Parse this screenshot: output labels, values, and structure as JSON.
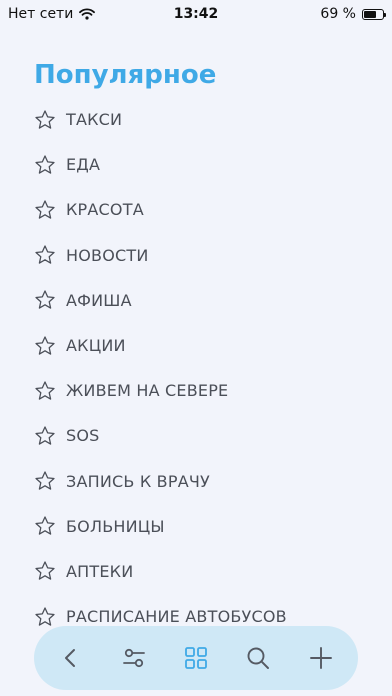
{
  "status_bar": {
    "carrier": "Нет сети",
    "time": "13:42",
    "battery": "69 %",
    "battery_level": 0.69
  },
  "page": {
    "title": "Популярное"
  },
  "items": [
    {
      "label": "ТАКСИ"
    },
    {
      "label": "ЕДА"
    },
    {
      "label": "КРАСОТА"
    },
    {
      "label": "НОВОСТИ"
    },
    {
      "label": "АФИША"
    },
    {
      "label": "АКЦИИ"
    },
    {
      "label": "ЖИВЕМ НА СЕВЕРЕ"
    },
    {
      "label": "SOS"
    },
    {
      "label": "ЗАПИСЬ К ВРАЧУ"
    },
    {
      "label": "БОЛЬНИЦЫ"
    },
    {
      "label": "АПТЕКИ"
    },
    {
      "label": "РАСПИСАНИЕ АВТОБУСОВ"
    }
  ],
  "bottom_bar": {
    "buttons": [
      {
        "icon": "back-icon",
        "active": false
      },
      {
        "icon": "filter-icon",
        "active": false
      },
      {
        "icon": "grid-icon",
        "active": true
      },
      {
        "icon": "search-icon",
        "active": false
      },
      {
        "icon": "plus-icon",
        "active": false
      }
    ]
  },
  "colors": {
    "accent": "#3fa9e6",
    "text": "#4b4f58",
    "background": "#f2f4fb",
    "tabbar": "#cfe8f6",
    "icon_inactive": "#555a63"
  }
}
